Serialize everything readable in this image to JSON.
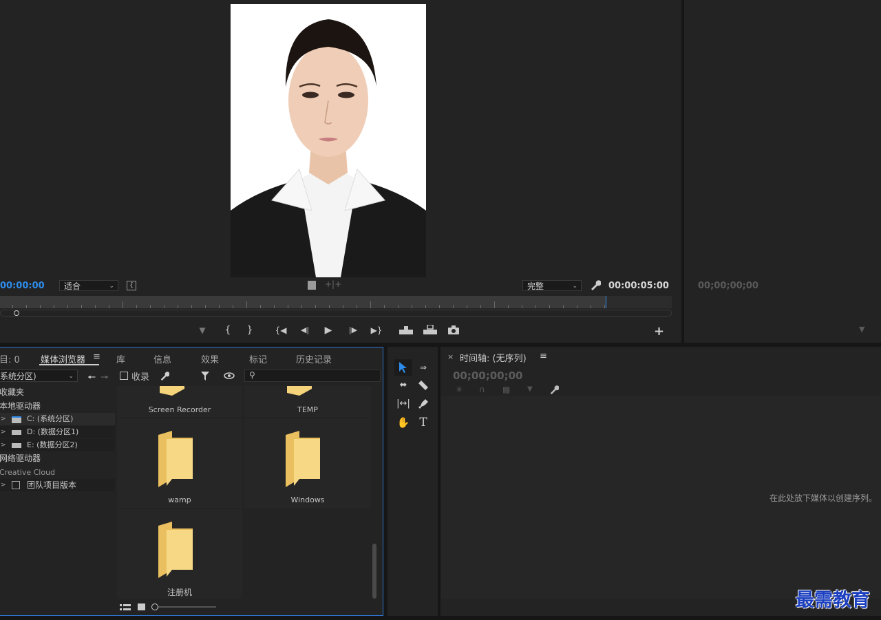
{
  "program_monitor": {
    "timecode_current": "00:00:00",
    "fit_select": "适合",
    "quality_select": "完整",
    "timecode_duration": "00:00:05:00"
  },
  "source_monitor": {
    "timecode": "00;00;00;00"
  },
  "project_panel": {
    "tabs": [
      "目: 0",
      "媒体浏览器",
      "库",
      "信息",
      "效果",
      "标记",
      "历史记录"
    ],
    "drive_select": "系统分区)",
    "ingest_label": "收录",
    "tree": [
      "收藏夹",
      "本地驱动器",
      "C: (系统分区)",
      "D: (数据分区1)",
      "E: (数据分区2)",
      "网络驱动器",
      "Creative Cloud",
      "团队项目版本"
    ],
    "tiles": [
      "Screen Recorder",
      "TEMP",
      "wamp",
      "Windows",
      "注册机"
    ]
  },
  "timeline": {
    "title": "时间轴: (无序列)",
    "timecode": "00;00;00;00",
    "drop_hint": "在此处放下媒体以创建序列。"
  },
  "watermark": "最需教育",
  "colors": {
    "accent_blue": "#2d8ceb",
    "panel_border": "#2d74cf",
    "folder_yellow": "#f5d37b"
  }
}
